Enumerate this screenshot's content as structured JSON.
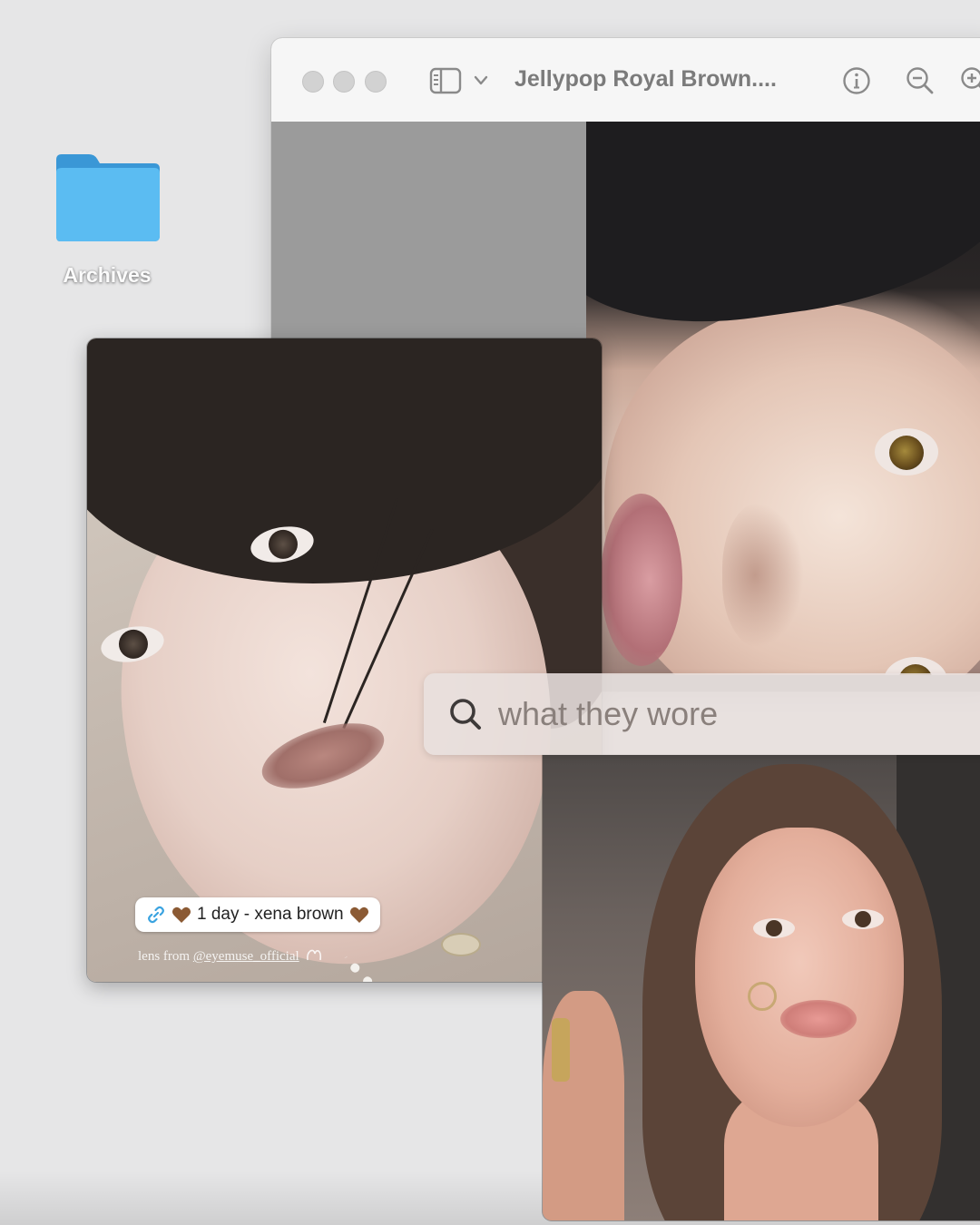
{
  "desktop": {
    "folder": {
      "label": "Archives",
      "icon": "folder-icon",
      "color": "#4cb1ea"
    }
  },
  "window": {
    "title": "Jellypop Royal Brown....",
    "toolbar": {
      "sidebar_icon": "sidebar-toggle-icon",
      "chevron_icon": "chevron-down-icon",
      "info_icon": "info-icon",
      "zoom_out_icon": "zoom-out-icon",
      "zoom_in_icon": "zoom-in-icon"
    }
  },
  "cards": {
    "left": {
      "sticker_text": "1 day - xena brown",
      "credit_prefix": "lens from ",
      "credit_handle": "@eyemuse_official"
    }
  },
  "search": {
    "placeholder": "what they wore",
    "icon": "search-icon"
  }
}
